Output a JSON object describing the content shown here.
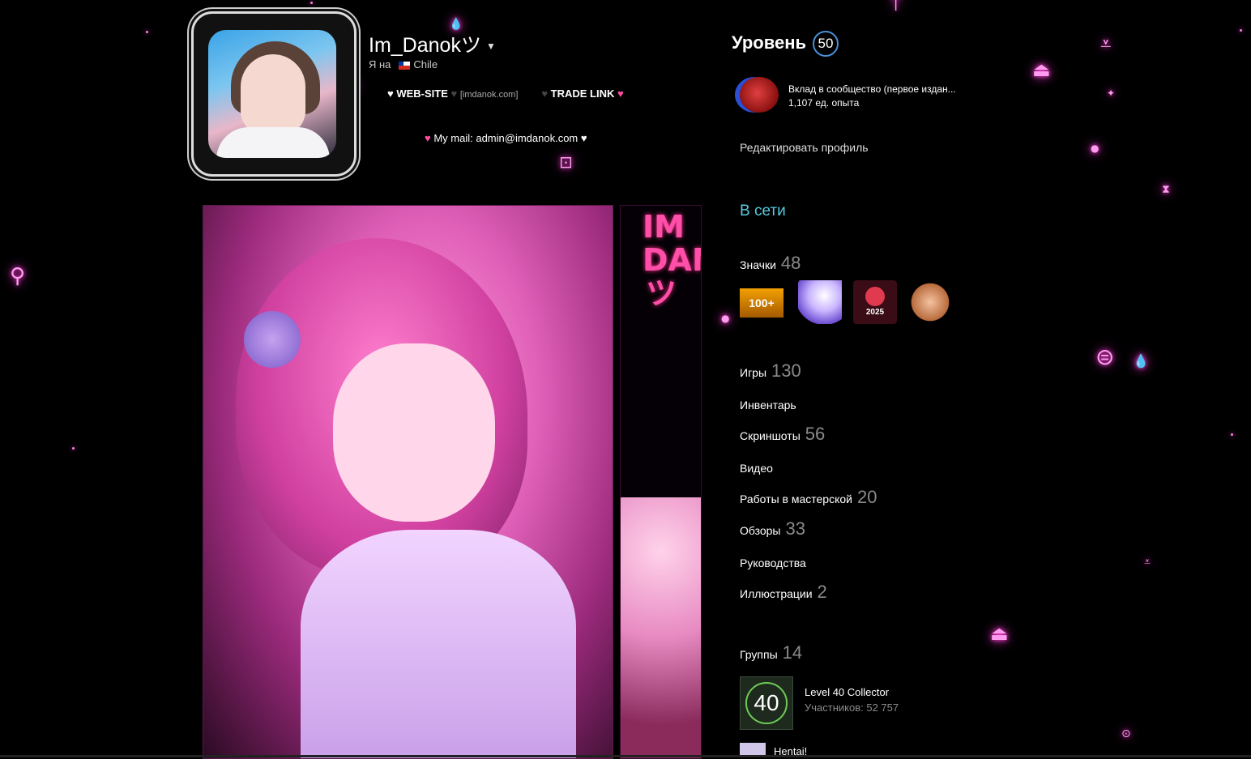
{
  "profile": {
    "persona_name": "Im_Danokツ",
    "location_prefix": "Я на",
    "country": "Chile",
    "website_label": "WEB-SITE",
    "website_url": "[imdanok.com]",
    "trade_label": "TRADE LINK",
    "mail_text": "My mail: admin@imdanok.com",
    "side_text": "IM DANOKツ"
  },
  "sidebar": {
    "level_label": "Уровень",
    "level_value": "50",
    "favorite_badge_name": "Вклад в сообщество (первое издан...",
    "favorite_badge_xp": "1,107 ед. опыта",
    "edit_profile": "Редактировать профиль",
    "status": "В сети",
    "badges_label": "Значки",
    "badges_count": "48",
    "badge_100_label": "100+",
    "badge_2025_label": "2025",
    "stats": [
      {
        "label": "Игры",
        "count": "130"
      },
      {
        "label": "Инвентарь",
        "count": ""
      },
      {
        "label": "Скриншоты",
        "count": "56"
      },
      {
        "label": "Видео",
        "count": ""
      },
      {
        "label": "Работы в мастерской",
        "count": "20"
      },
      {
        "label": "Обзоры",
        "count": "33"
      },
      {
        "label": "Руководства",
        "count": ""
      },
      {
        "label": "Иллюстрации",
        "count": "2"
      }
    ],
    "groups_label": "Группы",
    "groups_count": "14",
    "group1_icon_text": "40",
    "group1_name": "Level 40 Collector",
    "group1_members": "Участников: 52 757",
    "group2_name": "Hentai!"
  },
  "colors": {
    "background": "#000000",
    "neon": "#ff3cd6",
    "status_online": "#57cbde",
    "level_ring": "#4a8ed6"
  },
  "icons": [
    "heart-icon",
    "dropdown-caret-icon",
    "flag-chile-icon",
    "steam-icon"
  ]
}
